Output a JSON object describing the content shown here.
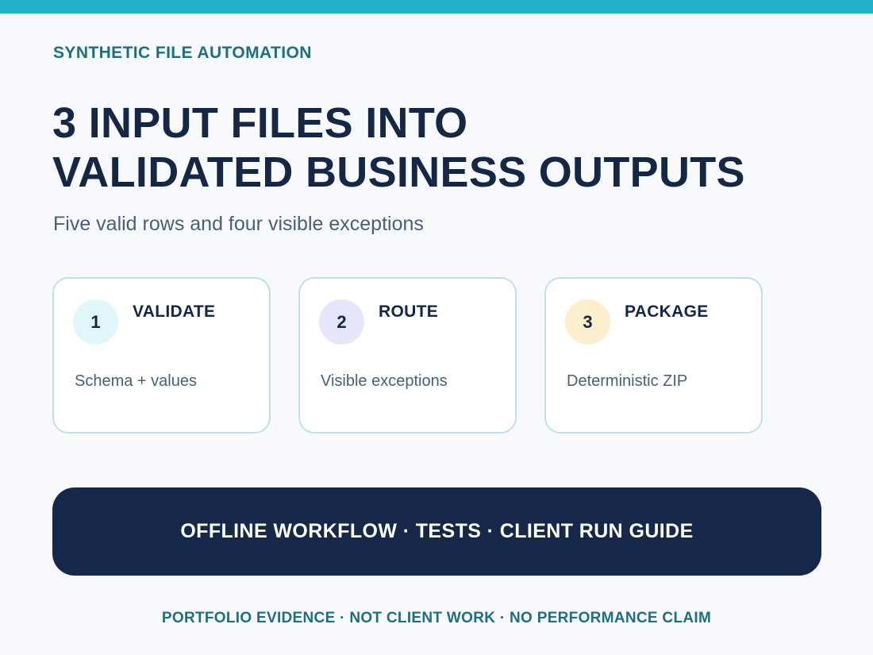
{
  "eyebrow": "SYNTHETIC FILE AUTOMATION",
  "headline": {
    "line1": "3 INPUT FILES INTO",
    "line2": "VALIDATED BUSINESS OUTPUTS"
  },
  "subtitle": "Five valid rows and four visible exceptions",
  "steps": [
    {
      "number": "1",
      "title": "VALIDATE",
      "description": "Schema + values",
      "accent": "#dff6fb"
    },
    {
      "number": "2",
      "title": "ROUTE",
      "description": "Visible exceptions",
      "accent": "#e6e6fb"
    },
    {
      "number": "3",
      "title": "PACKAGE",
      "description": "Deterministic ZIP",
      "accent": "#fdefcd"
    }
  ],
  "banner": "OFFLINE WORKFLOW · TESTS · CLIENT RUN GUIDE",
  "footer": "PORTFOLIO EVIDENCE · NOT CLIENT WORK · NO PERFORMANCE CLAIM",
  "colors": {
    "top_bar": "#22b0c7",
    "heading": "#142744",
    "accent_text": "#1d6f82",
    "banner_bg": "#16284a",
    "card_border": "#bfe0ea"
  }
}
